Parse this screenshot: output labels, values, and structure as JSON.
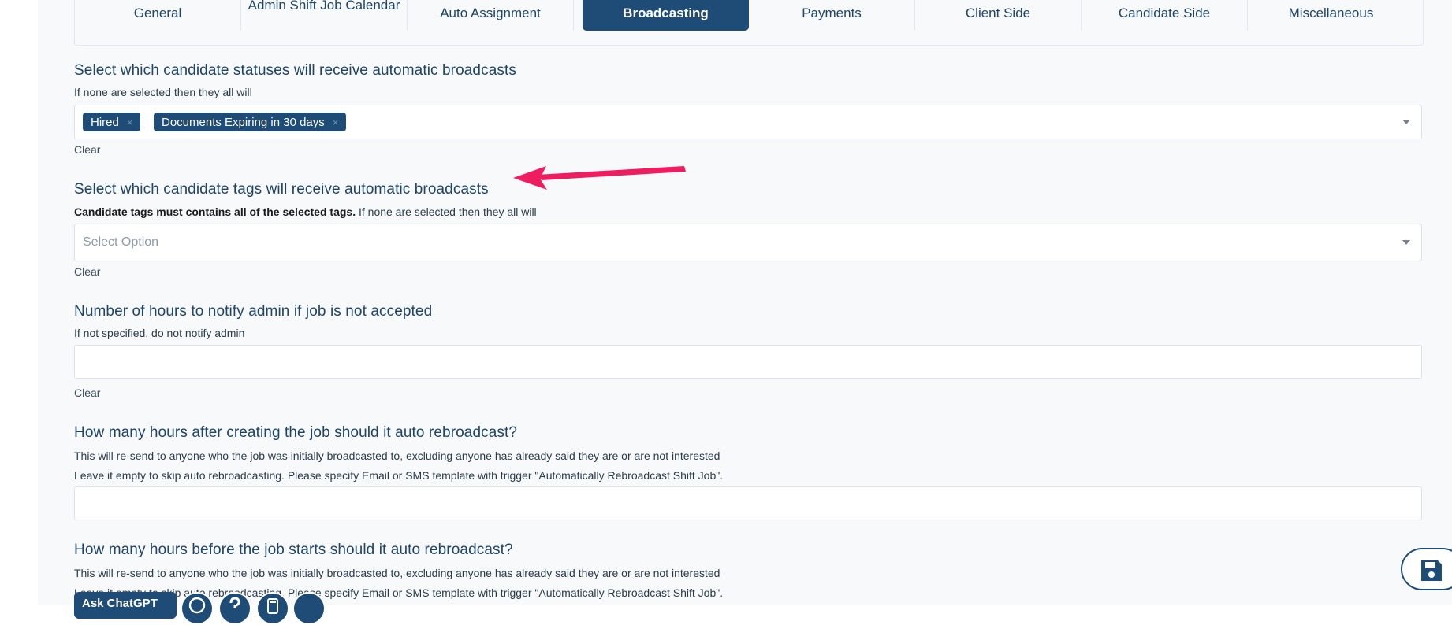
{
  "tabs": [
    {
      "label": "General",
      "active": false
    },
    {
      "label": "Admin Shift Job Calendar",
      "active": false
    },
    {
      "label": "Auto Assignment",
      "active": false
    },
    {
      "label": "Broadcasting",
      "active": true
    },
    {
      "label": "Payments",
      "active": false
    },
    {
      "label": "Client Side",
      "active": false
    },
    {
      "label": "Candidate Side",
      "active": false
    },
    {
      "label": "Miscellaneous",
      "active": false
    }
  ],
  "statuses": {
    "title": "Select which candidate statuses will receive automatic broadcasts",
    "help": "If none are selected then they all will",
    "selected": [
      "Hired",
      "Documents Expiring in 30 days"
    ],
    "remove_glyph": "×",
    "clear_label": "Clear"
  },
  "tags": {
    "title": "Select which candidate tags will receive automatic broadcasts",
    "help_bold": "Candidate tags must contains all of the selected tags.",
    "help_rest": " If none are selected then they all will",
    "placeholder": "Select Option",
    "clear_label": "Clear"
  },
  "notify": {
    "title": "Number of hours to notify admin if job is not accepted",
    "help": "If not specified, do not notify admin",
    "value": "",
    "clear_label": "Clear"
  },
  "rebroadcast_after": {
    "title": "How many hours after creating the job should it auto rebroadcast?",
    "help_1": "This will re-send to anyone who the job was initially broadcasted to, excluding anyone has already said they are or are not interested",
    "help_2": "Leave it empty to skip auto rebroadcasting. Please specify Email or SMS template with trigger \"Automatically Rebroadcast Shift Job\".",
    "value": ""
  },
  "rebroadcast_before": {
    "title": "How many hours before the job starts should it auto rebroadcast?",
    "help_1": "This will re-send to anyone who the job was initially broadcasted to, excluding anyone has already said they are or are not interested",
    "help_2": "Leave it empty to skip auto rebroadcasting. Please specify Email or SMS template with trigger \"Automatically Rebroadcast Shift Job\"."
  },
  "toolbar": {
    "ask_label": "Ask ChatGPT",
    "icons": [
      "whatsapp-icon",
      "help-icon",
      "calculator-icon",
      "more-icon"
    ]
  },
  "save_icon": "floppy-disk-icon",
  "colors": {
    "accent": "#1f4c77",
    "heading": "#1e4468",
    "arrow": "#ee1d5f",
    "background": "#f7f9fb"
  }
}
